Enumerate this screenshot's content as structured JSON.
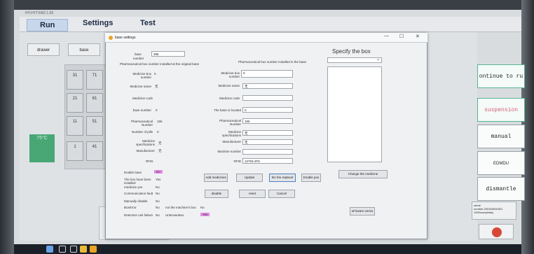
{
  "app": {
    "title": "HY-HYTXW2 1.05"
  },
  "menu": {
    "run": "Run",
    "settings": "Settings",
    "test": "Test"
  },
  "top_buttons": {
    "drawer": "drawer",
    "base": "base"
  },
  "grid": {
    "cells": [
      "31",
      "71",
      "21",
      "61",
      "11",
      "51",
      "1",
      "41"
    ]
  },
  "temperature": {
    "line1": "",
    "line2": "75°C"
  },
  "side_buttons": [
    "ontinue to ru",
    "suspension",
    "manual",
    "EDMDU",
    "dismantle"
  ],
  "side_status": {
    "line1": "serial",
    "line2": "number:230320000321",
    "line3": "1000completely"
  },
  "dialog": {
    "title": "base settings",
    "window_controls": {
      "min": "—",
      "max": "☐",
      "close": "✕"
    },
    "base_label": "base",
    "number_label": "number",
    "base_value": "395",
    "pharma_installed_original": "Pharmaceutical box number installed at the original base",
    "pharma_installed_base": "Pharmaceutical box number installed in the base",
    "left": {
      "medicine_box_label": "Medicine box",
      "medicine_box_label2": "number",
      "medicine_box_value": "0",
      "medicine_name_label": "Medicine name",
      "medicine_name_value": "无",
      "medicine_code_label": "Medicine code",
      "base_number_label": "base number",
      "base_number_value": "0",
      "pharma_number_label": "Pharmaceutical",
      "pharma_number_label2": "Number",
      "pharma_number_value": "155",
      "pills_label": "Number of pills",
      "pills_value": "0",
      "spec_label": "Medicine",
      "spec_label2": "specifications",
      "spec_value": "无",
      "manufacturer_label": "Manufacturer",
      "manufacturer_value": "无",
      "rfid_label": "RFID"
    },
    "right": {
      "medicine_box_label": "Medicine box",
      "medicine_box_label2": "number",
      "medicine_box_value": "0",
      "medicine_name_label": "Medicine name",
      "medicine_name_value": "无",
      "medicine_code_label": "Medicine code",
      "medicine_code_value": "",
      "located_label": "The base is located",
      "located_value": "0",
      "pharma_label": "Pharmaceutical",
      "pharma_label2": "Number",
      "pharma_value": "155",
      "spec_label": "Medicine",
      "spec_label2": "specifications",
      "spec_value": "无",
      "manufacturer_label": "Manufacturer",
      "manufacturer_value": "无",
      "machine_number_label": "Machine number",
      "machine_number_value": "",
      "rfid_label": "RFID",
      "rfid_value": "12753-4F5"
    },
    "status": {
      "enable_base_label": "Enable base",
      "enable_base_value": "No",
      "box_been_label": "The box have been",
      "box_been_label2": "installed",
      "box_been_value": "Yes",
      "medicine_yes_label": "medicine yes",
      "medicine_yes_value": "No",
      "comm_fault_label": "Communication fault",
      "comm_fault_value": "No",
      "manually_disable_label": "Manually disable",
      "manually_disable_value": "No",
      "box_error_label": "BoxError",
      "box_error_value": "No",
      "not_machine_box_label": "not the machine's box",
      "not_machine_box_value": "No",
      "detection_label": "Detection unit failure",
      "detection_value": "No",
      "unknown_box_label": "UnknownBox",
      "unknown_box_value": "Yes"
    },
    "buttons": {
      "add_medicines": "Add medicines",
      "update": "Update",
      "fen_replace": "fen the replacel",
      "enable_pos": "Enable pos",
      "disable": "disable",
      "reset": "reset",
      "cancel": "Cancel",
      "change_medicine": "Change the medicine",
      "ufirmware": "uFirware versio"
    },
    "specify_title": "Specify the box",
    "specify_select_arrow": "⌄"
  }
}
